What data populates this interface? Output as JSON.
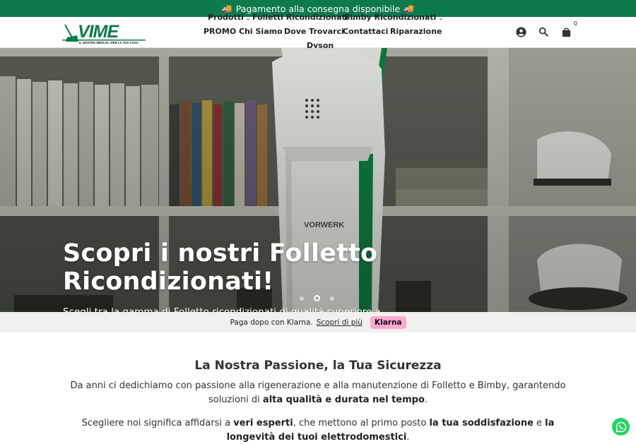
{
  "announcement": {
    "text": "Pagamento alla consegna disponibile"
  },
  "logo": {
    "name": "VIME",
    "tagline": "IL NOSTRO MEGLIO...PER LA TUA CASA"
  },
  "nav": {
    "row1": [
      {
        "label": "Prodotti",
        "dropdown": true
      },
      {
        "label": "Folletti Ricondizionati",
        "dropdown": true
      },
      {
        "label": "Bimby Ricondizionati",
        "dropdown": true
      }
    ],
    "row2": [
      {
        "label": "PROMO"
      },
      {
        "label": "Chi Siamo"
      },
      {
        "label": "Dove Trovarci"
      },
      {
        "label": "Contattaci"
      },
      {
        "label": "Riparazione"
      }
    ],
    "row3": [
      {
        "label": "Dyson"
      }
    ]
  },
  "header_icons": {
    "account": "account-icon",
    "search": "search-icon",
    "cart": "cart-icon",
    "cart_count": "0"
  },
  "hero": {
    "title": "Scopri i nostri Folletto Ricondizionati!",
    "subtitle": "Scegli tra la gamma di Folletto ricondizionati di qualità superiore a prezzi imbattibili!",
    "brand_on_vacuum": "VORWERK",
    "slides": 3,
    "active_slide": 2
  },
  "klarna": {
    "text": "Paga dopo con Klarna.",
    "link": "Scopri di più",
    "badge": "Klarna"
  },
  "content": {
    "title": "La Nostra Passione, la Tua Sicurezza",
    "p1_a": "Da anni ci dedichiamo con passione alla rigenerazione e alla manutenzione di Folletto e Bimby, garantendo soluzioni di ",
    "p1_b": "alta qualità e durata nel tempo",
    "p1_c": ".",
    "p2_a": "Scegliere noi significa affidarsi a ",
    "p2_b": "veri esperti",
    "p2_c": ", che mettono al primo posto ",
    "p2_d": "la tua soddisfazione",
    "p2_e": " e ",
    "p2_f": "la longevità dei tuoi elettrodomestici",
    "p2_g": "."
  },
  "colors": {
    "brand_green": "#0d7a4c",
    "klarna_pink": "#ffa8cd",
    "whatsapp": "#25d366"
  }
}
